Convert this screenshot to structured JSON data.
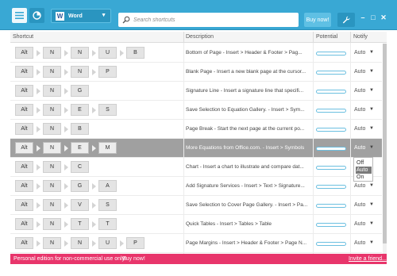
{
  "toolbar": {
    "app_name": "Word",
    "app_icon_letter": "W",
    "search_placeholder": "Search shortcuts",
    "buy_label": "Buy now!",
    "minimize_glyph": "–",
    "maximize_glyph": "□",
    "close_glyph": "✕"
  },
  "columns": {
    "shortcut": "Shortcut",
    "description": "Description",
    "potential": "Potential",
    "notify": "Notify"
  },
  "rows": [
    {
      "keys": [
        "Alt",
        "N",
        "N",
        "U",
        "B"
      ],
      "description": "Bottom of Page - Insert > Header & Footer > Pag...",
      "potential": 0.0,
      "notify": "Auto",
      "selected": false
    },
    {
      "keys": [
        "Alt",
        "N",
        "N",
        "P"
      ],
      "description": "Blank Page - Insert a new blank page at the cursor...",
      "potential": 0.0,
      "notify": "Auto",
      "selected": false
    },
    {
      "keys": [
        "Alt",
        "N",
        "G"
      ],
      "description": "Signature Line - Insert a signature line that specifi...",
      "potential": 0.0,
      "notify": "Auto",
      "selected": false
    },
    {
      "keys": [
        "Alt",
        "N",
        "E",
        "S"
      ],
      "description": "Save Selection to Equation Gallery. - Insert > Sym...",
      "potential": 0.0,
      "notify": "Auto",
      "selected": false
    },
    {
      "keys": [
        "Alt",
        "N",
        "B"
      ],
      "description": "Page Break - Start the next page at the current po...",
      "potential": 0.0,
      "notify": "Auto",
      "selected": false
    },
    {
      "keys": [
        "Alt",
        "N",
        "E",
        "M"
      ],
      "description": "More Equations from Office.com. - Insert > Symbols",
      "potential": 0.0,
      "notify": "Auto",
      "selected": true
    },
    {
      "keys": [
        "Alt",
        "N",
        "C"
      ],
      "description": "Chart - Insert a chart to illustrate and compare dat...",
      "potential": 0.0,
      "notify": "Auto",
      "selected": false
    },
    {
      "keys": [
        "Alt",
        "N",
        "G",
        "A"
      ],
      "description": "Add Signature Services - Insert > Text > Signature...",
      "potential": 0.0,
      "notify": "Auto",
      "selected": false
    },
    {
      "keys": [
        "Alt",
        "N",
        "V",
        "S"
      ],
      "description": "Save Selection to Cover Page Gallery. - Insert > Pa...",
      "potential": 0.0,
      "notify": "Auto",
      "selected": false
    },
    {
      "keys": [
        "Alt",
        "N",
        "T",
        "T"
      ],
      "description": "Quick Tables - Insert > Tables > Table",
      "potential": 0.0,
      "notify": "Auto",
      "selected": false
    },
    {
      "keys": [
        "Alt",
        "N",
        "N",
        "U",
        "P"
      ],
      "description": "Page Margins - Insert > Header & Footer > Page N...",
      "potential": 0.0,
      "notify": "Auto",
      "selected": false
    }
  ],
  "notify_dropdown": {
    "options": [
      "Off",
      "Auto",
      "On"
    ],
    "selected": "Auto"
  },
  "footer": {
    "notice": "Personal edition for non-commercial use only!",
    "buy_link": "Buy now!",
    "invite_link": "Invite a friend..."
  },
  "colors": {
    "titlebar": "#39a8d4",
    "footer": "#e8356b",
    "selected_row": "#a0a0a0"
  }
}
